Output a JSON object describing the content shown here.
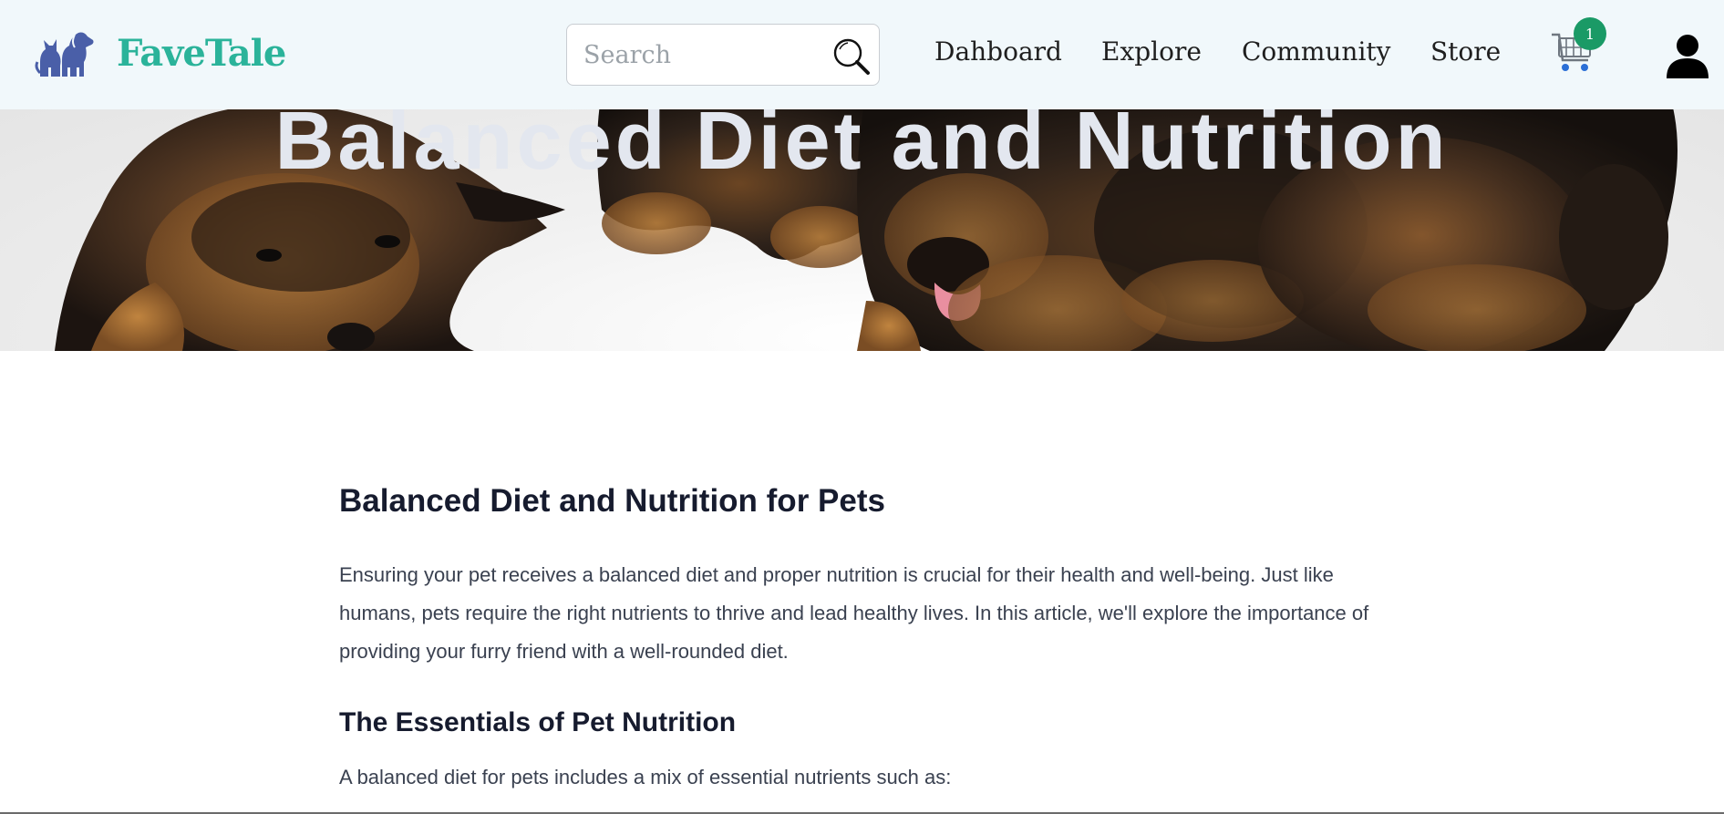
{
  "header": {
    "logo_text": "FaveTale",
    "logo_icon": "dog-cat-logo-icon",
    "search": {
      "placeholder": "Search",
      "value": "",
      "icon": "search-icon"
    },
    "nav": [
      {
        "label": "Dahboard"
      },
      {
        "label": "Explore"
      },
      {
        "label": "Community"
      },
      {
        "label": "Store"
      }
    ],
    "cart": {
      "icon": "cart-icon",
      "count": "1"
    },
    "user": {
      "icon": "user-icon"
    }
  },
  "hero": {
    "title": "Balanced Diet and Nutrition",
    "image": "puppies-hero-image"
  },
  "article": {
    "heading": "Balanced Diet and Nutrition for Pets",
    "intro": "Ensuring your pet receives a balanced diet and proper nutrition is crucial for their health and well-being. Just like humans, pets require the right nutrients to thrive and lead healthy lives. In this article, we'll explore the importance of providing your furry friend with a well-rounded diet.",
    "section_heading": "The Essentials of Pet Nutrition",
    "section_text": "A balanced diet for pets includes a mix of essential nutrients such as:"
  },
  "colors": {
    "header_bg": "#f1f8fb",
    "brand": "#2bb39a",
    "logo_icon": "#4a5fa8",
    "badge": "#1a9a66",
    "heading_text": "#161b2e",
    "body_text": "#3a4150"
  }
}
